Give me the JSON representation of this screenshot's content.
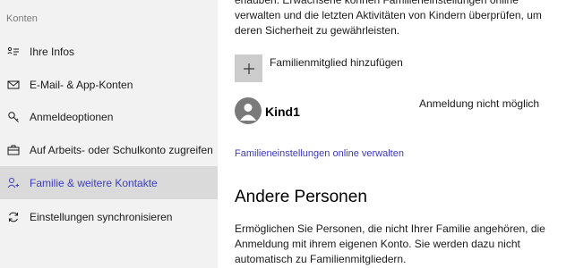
{
  "sidebar": {
    "section_header": "Konten",
    "items": [
      {
        "label": "Ihre Infos",
        "icon": "user-card-icon"
      },
      {
        "label": "E-Mail- & App-Konten",
        "icon": "mail-icon"
      },
      {
        "label": "Anmeldeoptionen",
        "icon": "key-icon"
      },
      {
        "label": "Auf Arbeits- oder Schulkonto zugreifen",
        "icon": "briefcase-icon"
      },
      {
        "label": "Familie & weitere Kontakte",
        "icon": "person-add-icon",
        "active": true
      },
      {
        "label": "Einstellungen synchronisieren",
        "icon": "sync-icon"
      }
    ]
  },
  "main": {
    "intro_text": "erlauben. Erwachsene können Familieneinstellungen online verwalten und die letzten Aktivitäten von Kindern überprüfen, um deren Sicherheit zu gewährleisten.",
    "add_member_label": "Familienmitglied hinzufügen",
    "member": {
      "name": "Kind1",
      "status": "Anmeldung nicht möglich"
    },
    "family_link": "Familieneinstellungen online verwalten",
    "other_title": "Andere Personen",
    "other_desc": "Ermöglichen Sie Personen, die nicht Ihrer Familie angehören, die Anmeldung mit ihrem eigenen Konto. Sie werden dazu nicht automatisch zu Familienmitgliedern."
  },
  "colors": {
    "sidebar_bg": "#f2f2f2",
    "active_item_bg": "#dadada",
    "accent": "#3d3dc4",
    "tile_bg": "#cccccc",
    "avatar_bg": "#7a7a7a"
  }
}
